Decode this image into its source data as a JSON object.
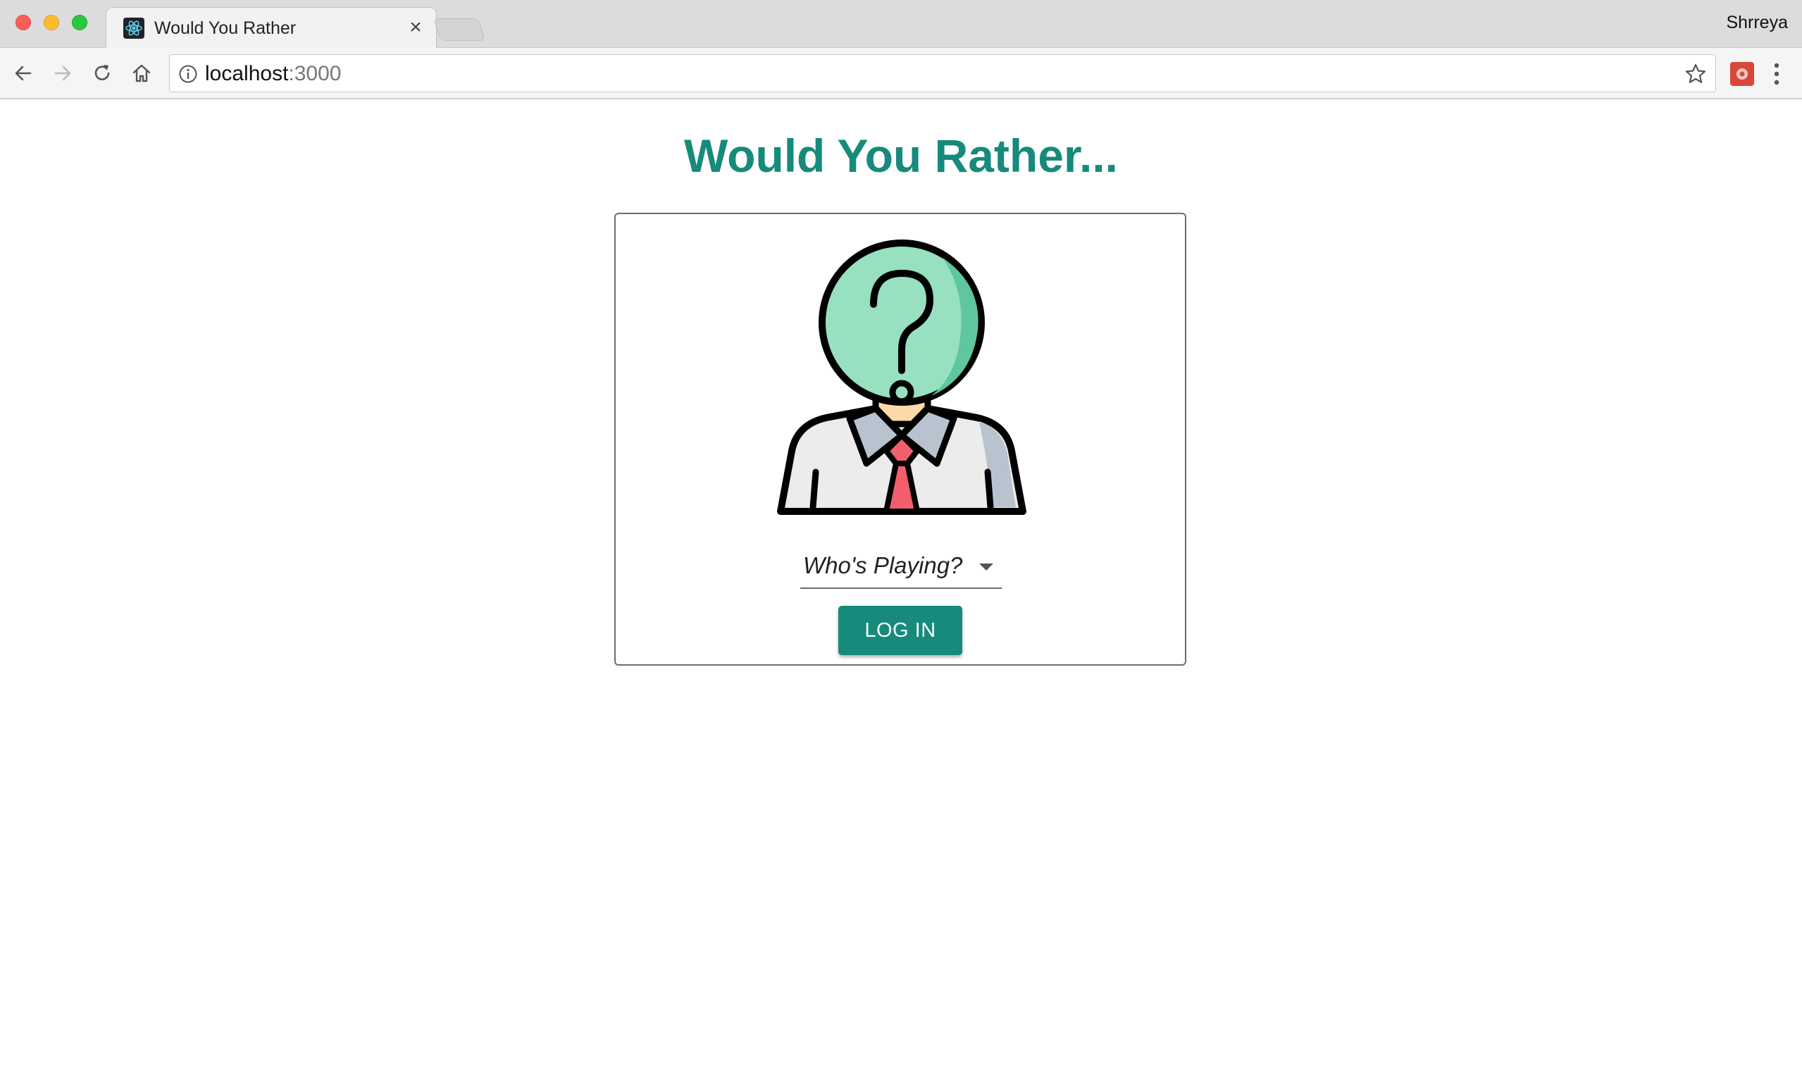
{
  "browser": {
    "tab_title": "Would You Rather",
    "tab_close_glyph": "×",
    "profile_name": "Shrreya",
    "url_host": "localhost",
    "url_port": ":3000",
    "icons": {
      "favicon": "react-logo-icon",
      "back": "back-arrow-icon",
      "forward": "forward-arrow-icon",
      "reload": "reload-icon",
      "home": "home-icon",
      "site_info": "info-icon",
      "bookmark": "star-icon",
      "extension": "extension-icon",
      "menu": "kebab-menu-icon"
    }
  },
  "app": {
    "title": "Would You Rather...",
    "accent_color": "#168a7b",
    "avatar_icon": "unknown-user-icon",
    "user_select": {
      "placeholder": "Who's Playing?"
    },
    "login_button": "LOG IN"
  }
}
